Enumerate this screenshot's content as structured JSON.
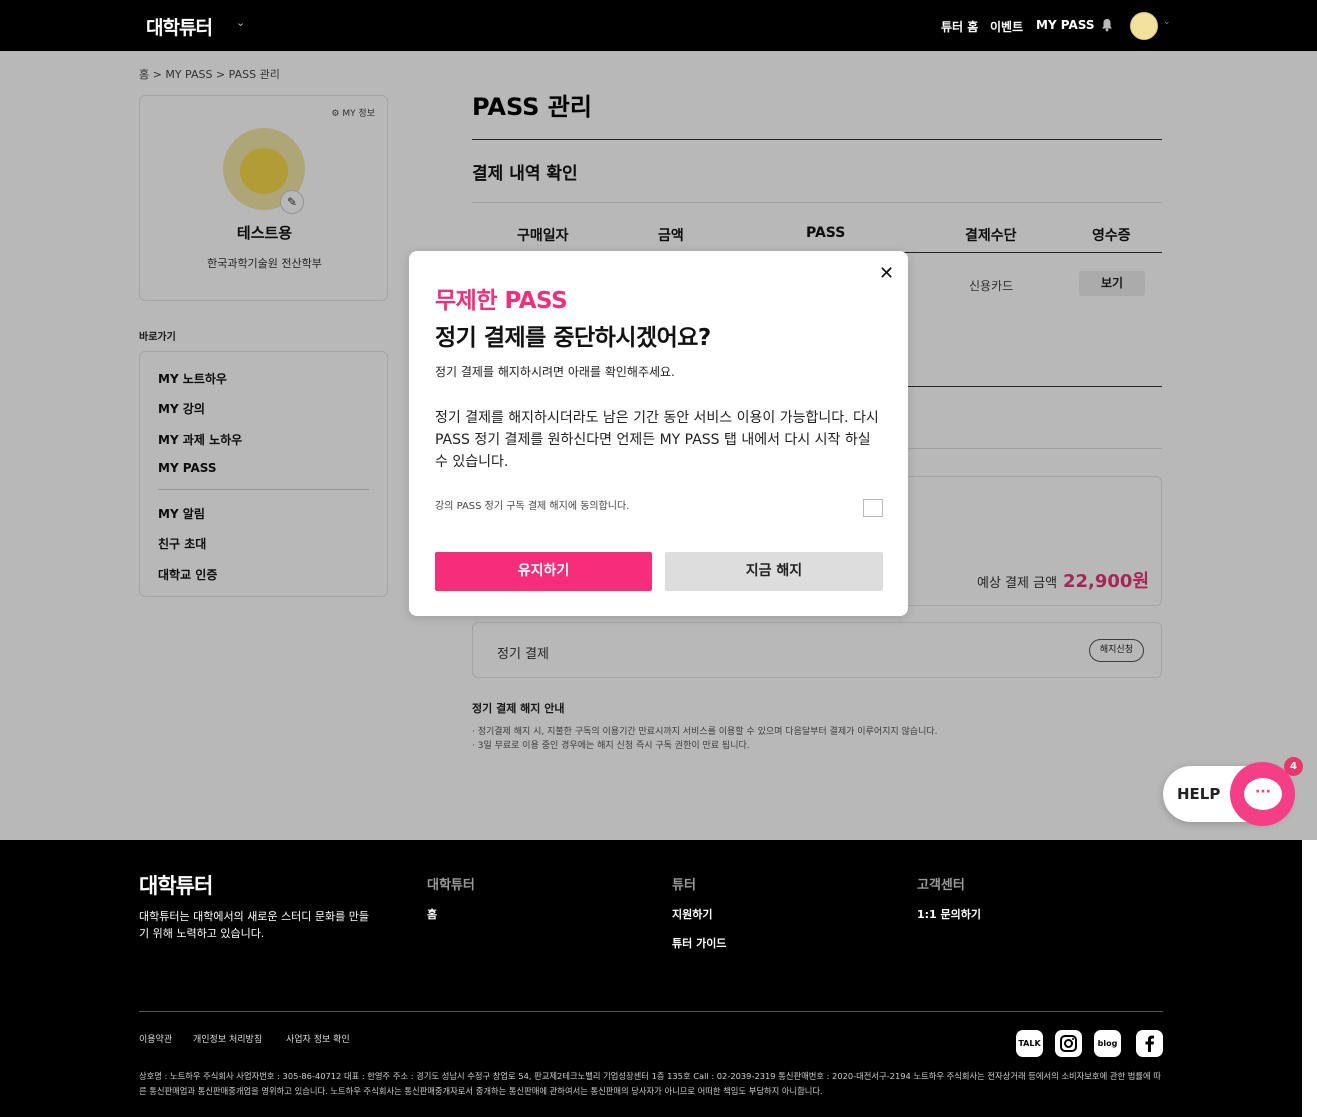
{
  "header": {
    "logo": "대학튜터",
    "nav": [
      "튜터 홈",
      "이벤트",
      "MY PASS"
    ]
  },
  "breadcrumb": "홈 > MY PASS > PASS 관리",
  "profile": {
    "my_info_label": "MY 정보",
    "name": "테스트용",
    "school": "한국과학기술원 전산학부"
  },
  "shortcuts": {
    "label": "바로가기",
    "items": [
      "MY 노트하우",
      "MY 강의",
      "MY 과제 노하우",
      "MY PASS",
      "MY 알림",
      "친구 초대",
      "대학교 인증"
    ]
  },
  "main": {
    "title": "PASS 관리",
    "section_title": "결제 내역 확인",
    "columns": [
      "구매일자",
      "금액",
      "PASS",
      "결제수단",
      "영수증"
    ],
    "row": {
      "method": "신용카드",
      "receipt_button": "보기"
    },
    "expected_label": "예상 결제 금액",
    "expected_value": "22,900원",
    "subscription_label": "정기 결제",
    "cancel_request": "해지신청",
    "notice_title": "정기 결제 해지 안내",
    "notice_lines": [
      "· 정기결제 해지 시, 지불한 구독의 이용기간 만료시까지 서비스를 이용할 수 있으며 다음달부터 결제가 이루어지지 않습니다.",
      "· 3일 무료로 이용 중인 경우에는 해지 신청 즉시 구독 권한이 만료 됩니다."
    ]
  },
  "modal": {
    "highlight": "무제한 PASS",
    "title": "정기 결제를 중단하시겠어요?",
    "subtitle": "정기 결제를 해지하시려면 아래를 확인해주세요.",
    "body": "정기 결제를 해지하시더라도 남은 기간 동안 서비스 이용이 가능합니다. 다시 PASS 정기 결제를 원하신다면 언제든 MY PASS 탭 내에서 다시 시작 하실 수 있습니다.",
    "agree_text": "강의 PASS 정기 구독 결제 해지에 동의합니다.",
    "keep_button": "유지하기",
    "cancel_button": "지금 해지"
  },
  "help": {
    "label": "HELP",
    "badge": "4"
  },
  "footer": {
    "logo": "대학튜터",
    "description": "대학튜터는 대학에서의 새로운 스터디 문화를 만들기 위해 노력하고 있습니다.",
    "columns": [
      {
        "title": "대학튜터",
        "links": [
          "홈"
        ]
      },
      {
        "title": "튜터",
        "links": [
          "지원하기",
          "튜터 가이드"
        ]
      },
      {
        "title": "고객센터",
        "links": [
          "1:1 문의하기"
        ]
      }
    ],
    "policies": [
      "이용약관",
      "개인정보 처리방침",
      "사업자 정보 확인"
    ],
    "social": [
      "TALK",
      "instagram",
      "blog",
      "facebook"
    ],
    "legal": "상호명 : 노트하우 주식회사 사업자번호 : 305-86-40712 대표 : 한영주 주소 : 경기도 성남시 수정구 창업로 54, 판교제2테크노밸리 기업성장센터 1층 135호 Call : 02-2039-2319 통신판매번호 : 2020-대전서구-2194 노트하우 주식회사는 전자상거래 등에서의 소비자보호에 관한 법률에 따른 통신판매업과 통신판매중개업을 영위하고 있습니다. 노트하우 주식회사는 통신판매중개자로서 중개하는 통신판매에 관하여서는 통신판매의 당사자가 아니므로 어떠한 책임도 부담하지 아니합니다."
  }
}
